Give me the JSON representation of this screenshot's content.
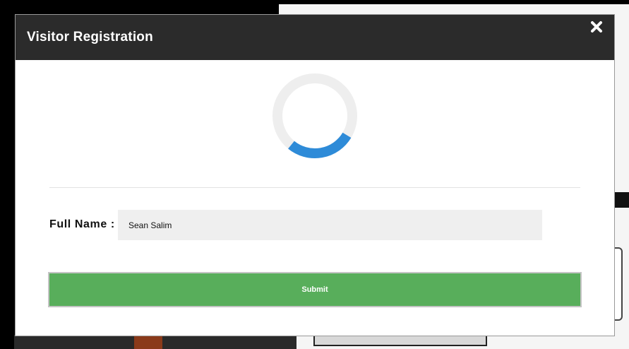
{
  "modal": {
    "title": "Visitor Registration",
    "close_icon": "close-icon"
  },
  "spinner": {
    "icon": "loading-spinner-icon",
    "track_color": "#eeeeee",
    "arc_color": "#2e8bd8"
  },
  "form": {
    "full_name_label": "Full Name :",
    "full_name_value": "Sean Salim",
    "submit_label": "Submit"
  },
  "colors": {
    "header_bg": "#2b2b2b",
    "submit_bg": "#58ae5b",
    "input_bg": "#efefef"
  }
}
